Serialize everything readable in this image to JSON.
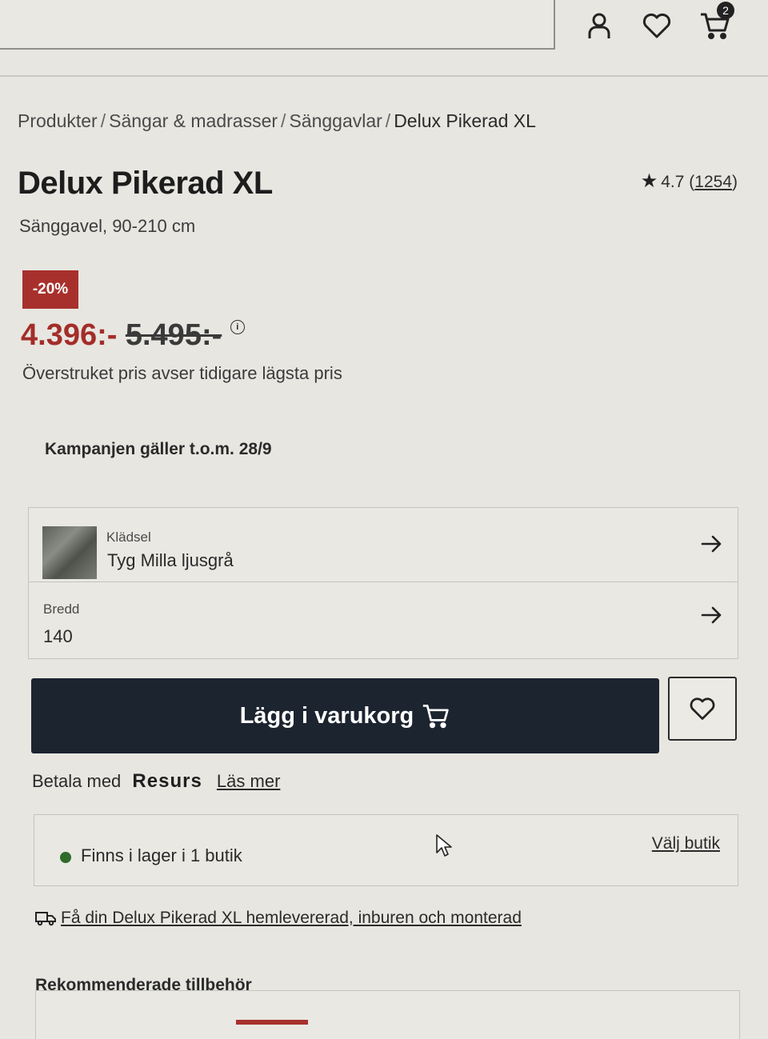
{
  "header": {
    "icons": [
      "user-icon",
      "heart-icon",
      "cart-icon"
    ],
    "cart_count": "2"
  },
  "breadcrumb": {
    "items": [
      "Produkter",
      "Sängar & madrasser",
      "Sänggavlar"
    ],
    "current": "Delux Pikerad XL",
    "separator": "/"
  },
  "product": {
    "title": "Delux Pikerad XL",
    "subtitle": "Sänggavel, 90-210 cm",
    "rating": "4.7",
    "review_count": "1254",
    "discount": "-20%",
    "price_now": "4.396:-",
    "price_old": "5.495:-",
    "price_note": "Överstruket pris avser tidigare lägsta pris",
    "campaign": "Kampanjen gäller t.o.m. 28/9"
  },
  "options": {
    "upholstery_label": "Klädsel",
    "upholstery_value": "Tyg Milla ljusgrå",
    "width_label": "Bredd",
    "width_value": "140"
  },
  "actions": {
    "add_to_cart": "Lägg i varukorg"
  },
  "payment": {
    "prefix": "Betala med",
    "provider": "Resurs",
    "read_more": "Läs mer"
  },
  "stock": {
    "text": "Finns i lager i 1 butik",
    "choose_store": "Välj butik"
  },
  "delivery": {
    "text": "Få din Delux Pikerad XL hemlevererad, inburen och monterad"
  },
  "recommended": {
    "title": "Rekommenderade tillbehör"
  },
  "colors": {
    "accent_red": "#a8302c",
    "button_dark": "#1c2430",
    "stock_green": "#2f6b2a"
  }
}
